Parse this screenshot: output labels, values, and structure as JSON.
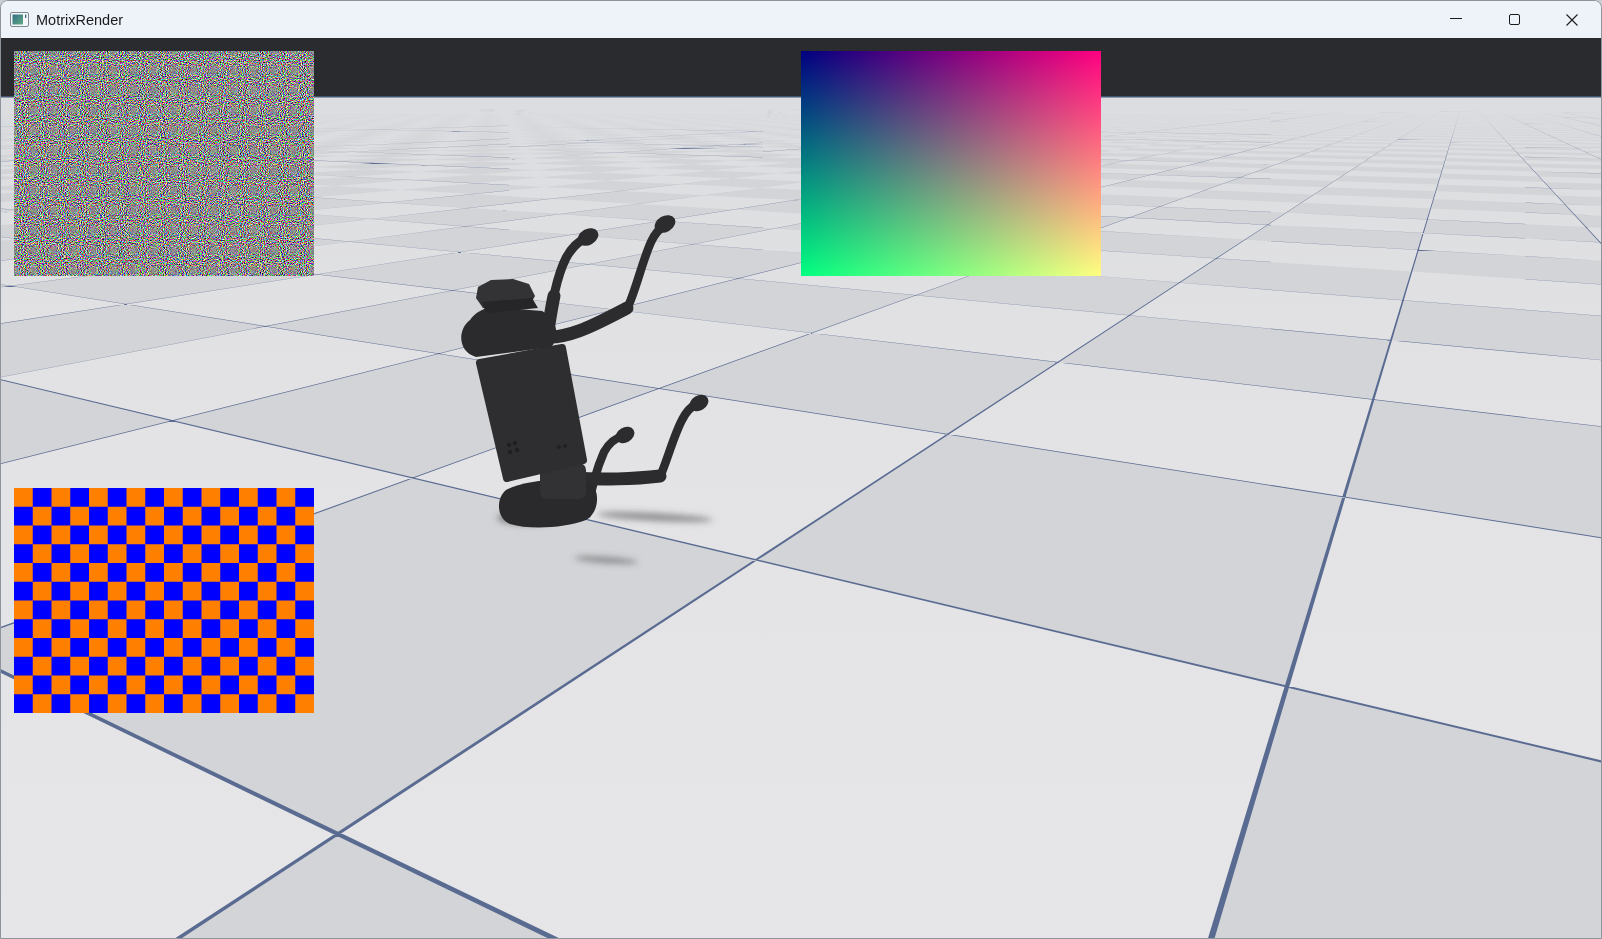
{
  "window": {
    "title": "MotrixRender"
  }
}
